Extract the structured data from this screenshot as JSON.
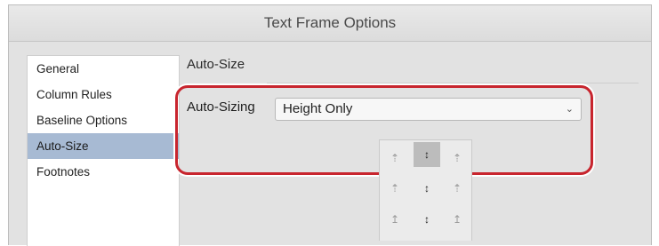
{
  "window": {
    "title": "Text Frame Options"
  },
  "sidebar": {
    "items": [
      {
        "label": "General",
        "selected": false
      },
      {
        "label": "Column Rules",
        "selected": false
      },
      {
        "label": "Baseline Options",
        "selected": false
      },
      {
        "label": "Auto-Size",
        "selected": true
      },
      {
        "label": "Footnotes",
        "selected": false
      }
    ]
  },
  "panel": {
    "section_title": "Auto-Size",
    "auto_sizing": {
      "label": "Auto-Sizing",
      "value": "Height Only"
    },
    "reference_point": {
      "cells": [
        {
          "glyph": "⇡",
          "active": false
        },
        {
          "glyph": "↕",
          "active": true
        },
        {
          "glyph": "⇡",
          "active": false
        },
        {
          "glyph": "⇡",
          "active": false
        },
        {
          "glyph": "↕",
          "active": false
        },
        {
          "glyph": "⇡",
          "active": false
        },
        {
          "glyph": "↥",
          "active": false
        },
        {
          "glyph": "↕",
          "active": false
        },
        {
          "glyph": "↥",
          "active": false
        }
      ]
    }
  },
  "colors": {
    "highlight": "#c8252e",
    "selected_item": "#a7bad3"
  }
}
